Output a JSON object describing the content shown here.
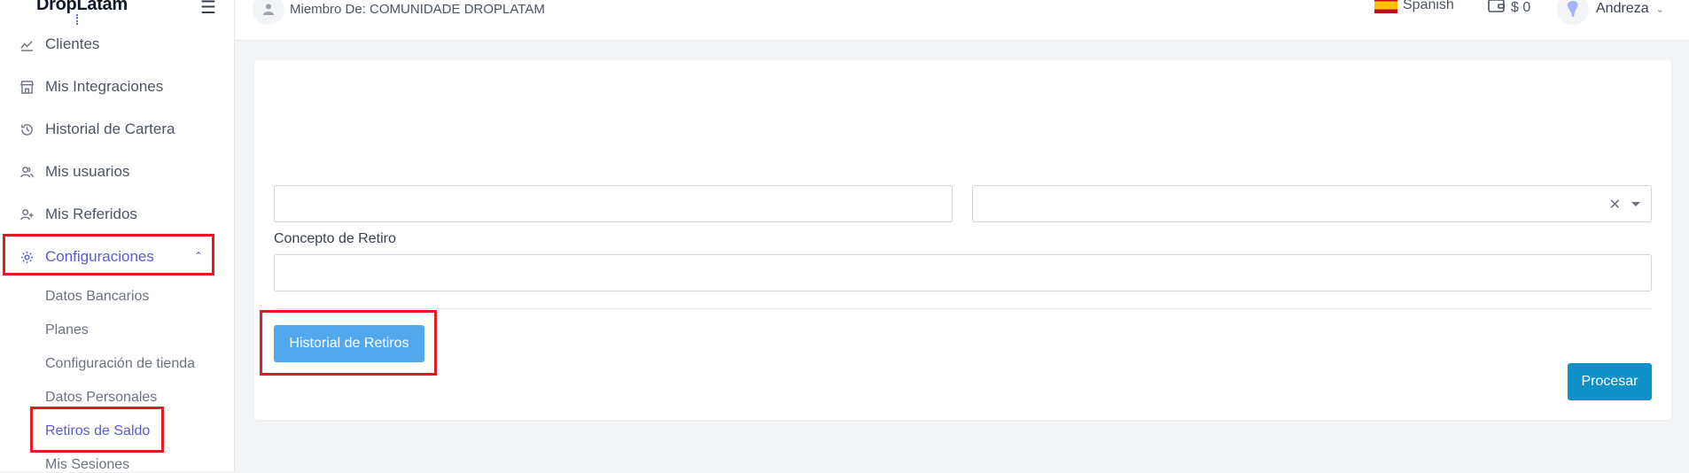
{
  "brand": {
    "name": "DropLatam"
  },
  "header": {
    "member_label": "Miembro De: COMUNIDADE DROPLATAM",
    "language": "Spanish",
    "balance": "$ 0",
    "user_name": "Andreza"
  },
  "sidebar": {
    "items": [
      {
        "label": "Clientes",
        "icon": "chart-line-icon"
      },
      {
        "label": "Mis Integraciones",
        "icon": "store-icon"
      },
      {
        "label": "Historial de Cartera",
        "icon": "history-icon"
      },
      {
        "label": "Mis usuarios",
        "icon": "users-icon"
      },
      {
        "label": "Mis Referidos",
        "icon": "user-plus-icon"
      },
      {
        "label": "Configuraciones",
        "icon": "gear-icon",
        "active": true
      }
    ],
    "subitems": [
      {
        "label": "Datos Bancarios"
      },
      {
        "label": "Planes"
      },
      {
        "label": "Configuración de tienda"
      },
      {
        "label": "Datos Personales"
      },
      {
        "label": "Retiros de Saldo",
        "active": true
      },
      {
        "label": "Mis Sesiones"
      }
    ]
  },
  "form": {
    "amount_value": "",
    "account_value": "",
    "concept_label": "Concepto de Retiro",
    "concept_value": "",
    "history_button": "Historial de Retiros",
    "process_button": "Procesar"
  },
  "colors": {
    "accent": "#5b5bd6",
    "highlight": "#e11d24",
    "history_button": "#52a8ec",
    "process_button": "#0e90c8"
  }
}
